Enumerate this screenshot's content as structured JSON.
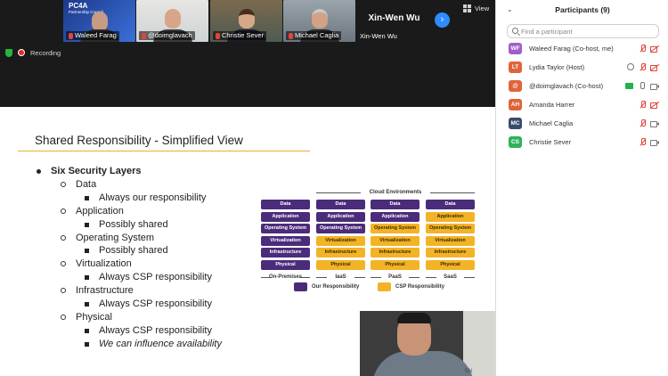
{
  "gallery": {
    "tiles": [
      {
        "name": "Waleed Farag",
        "logo": "PC4A",
        "logo_sub": "Partnership Council"
      },
      {
        "name": "@doimglavach"
      },
      {
        "name": "Christie Sever"
      },
      {
        "name": "Michael Caglia"
      },
      {
        "name": "Xin-Wen Wu",
        "display_name": "Xin-Wen Wu"
      }
    ],
    "next_glyph": "›",
    "view_label": "View"
  },
  "recording": {
    "label": "Recording"
  },
  "slide": {
    "title": "Shared Responsibility - Simplified View",
    "heading": "Six Security Layers",
    "layers": [
      {
        "name": "Data",
        "note": "Always our responsibility"
      },
      {
        "name": "Application",
        "note": "Possibly shared"
      },
      {
        "name": "Operating System",
        "note": "Possibly shared"
      },
      {
        "name": "Virtualization",
        "note": "Always CSP responsibility"
      },
      {
        "name": "Infrastructure",
        "note": "Always CSP responsibility"
      },
      {
        "name": "Physical",
        "note": "Always CSP responsibility",
        "note2": "We can influence availability"
      }
    ],
    "diagram": {
      "title": "Cloud Environments",
      "rows": [
        "Data",
        "Application",
        "Operating System",
        "Virtualization",
        "Infrastructure",
        "Physical"
      ],
      "columns": [
        {
          "label": "On-Premises",
          "csp_from": 6
        },
        {
          "label": "IaaS",
          "csp_from": 3
        },
        {
          "label": "PaaS",
          "csp_from": 2
        },
        {
          "label": "SaaS",
          "csp_from": 1
        }
      ],
      "legend_ours": "Our Responsibility",
      "legend_csp": "CSP Responsibility",
      "color_ours": "#4b2c7a",
      "color_csp": "#f3b326"
    },
    "speaker_tag": "SN"
  },
  "participants": {
    "title": "Participants (9)",
    "collapse_glyph": "⌄",
    "search_placeholder": "Find a participant",
    "list": [
      {
        "initials": "WF",
        "color": "#a05fc7",
        "name": "Waleed Farag (Co-host, me)",
        "mic": "muted",
        "cam": "off"
      },
      {
        "initials": "LT",
        "color": "#e0643a",
        "name": "Lydia Taylor (Host)",
        "mic": "muted",
        "cam": "off",
        "host": true
      },
      {
        "initials": "@",
        "color": "#e0643a",
        "name": "@doimglavach (Co-host)",
        "mic": "on",
        "cam": "on",
        "share": true
      },
      {
        "initials": "AH",
        "color": "#e0643a",
        "name": "Amanda Harrer",
        "mic": "muted",
        "cam": "off"
      },
      {
        "initials": "MC",
        "color": "#3a4a6a",
        "name": "Michael Caglia",
        "mic": "muted",
        "cam": "on"
      },
      {
        "initials": "CS",
        "color": "#2fb25a",
        "name": "Christie Sever",
        "mic": "muted",
        "cam": "on"
      }
    ]
  }
}
